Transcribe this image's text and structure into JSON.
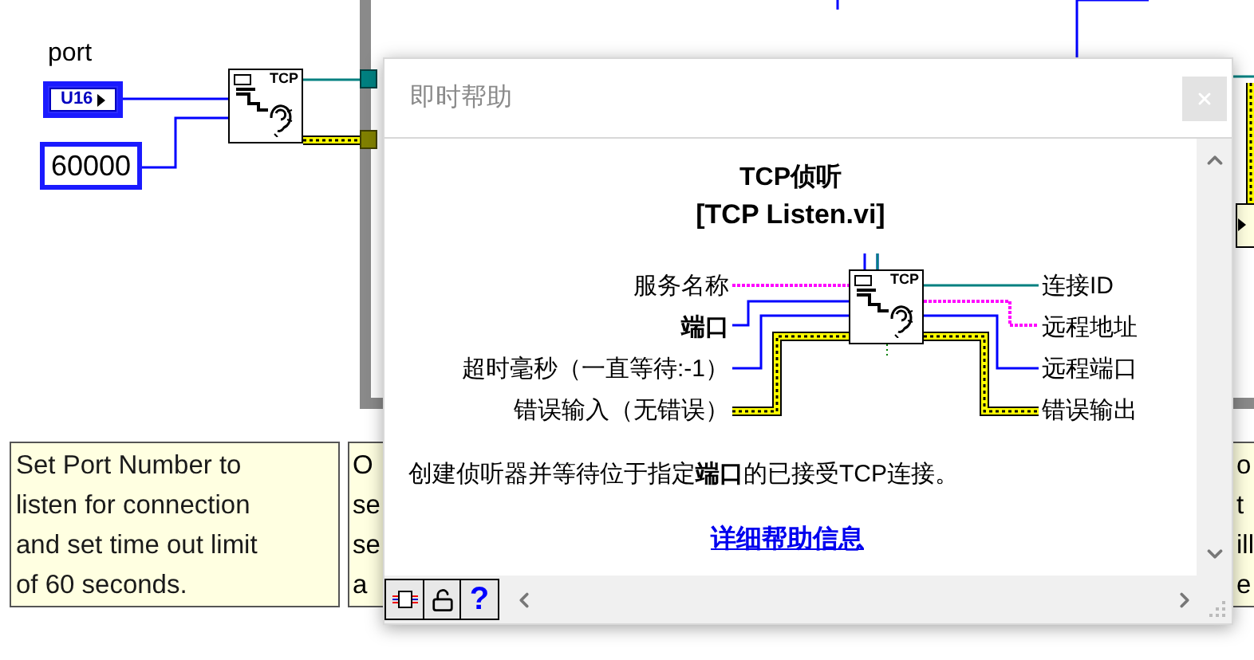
{
  "diagram": {
    "control_label": "port",
    "control_type": "U16",
    "constant": "60000",
    "node_text": "TCP",
    "comments": [
      {
        "lines": [
          "Set Port Number to",
          "listen for connection",
          "and set time out limit",
          "of 60 seconds."
        ]
      },
      {
        "lines": [
          "O",
          "se",
          "se",
          "a"
        ]
      },
      {
        "lines": [
          "o",
          "t",
          "ill",
          "e"
        ]
      }
    ]
  },
  "help_window": {
    "title": "即时帮助",
    "vi_name": "TCP侦听",
    "vi_file": "[TCP Listen.vi]",
    "icon_text": "TCP",
    "inputs": [
      {
        "label": "服务名称",
        "kind": "string",
        "required": false
      },
      {
        "label": "端口",
        "kind": "numeric",
        "required": true
      },
      {
        "label": "超时毫秒（一直等待:-1）",
        "kind": "numeric",
        "required": false
      },
      {
        "label": "错误输入（无错误）",
        "kind": "error",
        "required": false
      }
    ],
    "outputs": [
      {
        "label": "连接ID",
        "kind": "refnum"
      },
      {
        "label": "远程地址",
        "kind": "string"
      },
      {
        "label": "远程端口",
        "kind": "numeric"
      },
      {
        "label": "错误输出",
        "kind": "error"
      }
    ],
    "description": "创建侦听器并等待位于指定**端口**的已接受TCP连接。",
    "link": "详细帮助信息",
    "help_button": "?"
  }
}
